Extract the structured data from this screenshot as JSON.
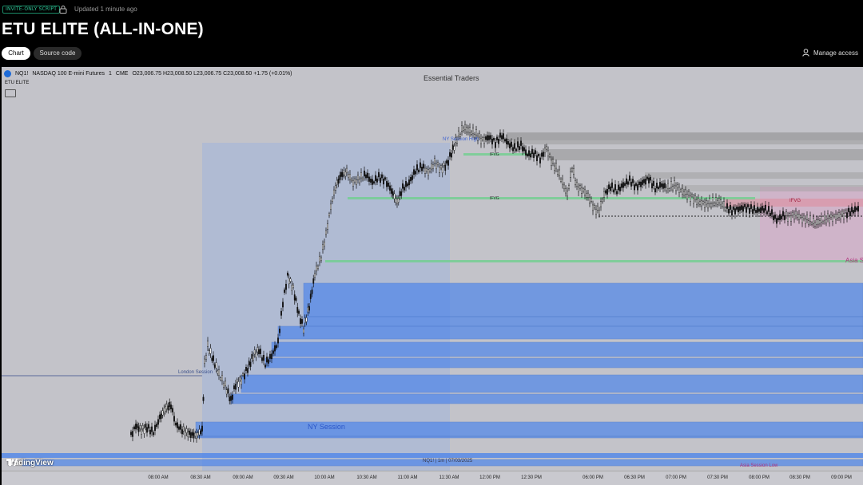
{
  "header": {
    "badge": "INVITE-ONLY SCRIPT",
    "updated": "Updated 1 minute ago",
    "title": "ETU ELITE (ALL-IN-ONE)",
    "tabs": [
      {
        "label": "Chart"
      },
      {
        "label": "Source code"
      }
    ],
    "manage_access": "Manage access"
  },
  "chart": {
    "symbol": "NQ1!",
    "description": "NASDAQ 100 E-mini Futures",
    "interval": "1",
    "exchange": "CME",
    "ohlc": "O23,006.75  H23,008.50  L23,006.75  C23,008.50  +1.75 (+0.01%)",
    "indicator": "ETU ELITE",
    "watermark": "Essential Traders",
    "brand": "TradingView",
    "footer": "NQ1!  |  1m  |  07/03/2025",
    "labels": {
      "ny_session_high": "NY Session High",
      "ny_session": "NY Session",
      "london_session": "London Session",
      "asia_s": "Asia S",
      "asia_session_low": "Asia Session Low",
      "ifvg": "IFVG"
    },
    "time_ticks": [
      "08:00 AM",
      "08:30 AM",
      "09:00 AM",
      "09:30 AM",
      "10:00 AM",
      "10:30 AM",
      "11:00 AM",
      "11:30 AM",
      "12:00 PM",
      "12:30 PM",
      "06:00 PM",
      "06:30 PM",
      "07:00 PM",
      "07:30 PM",
      "08:00 PM",
      "08:30 PM",
      "09:00 PM"
    ],
    "colors": {
      "background": "#c3c3c9",
      "ny_session_zone": "#a9b8d6",
      "fvg_blue": "#4f86ea",
      "ifvg_green": "#6fcf8f",
      "asia_zone": "#d9a8c8",
      "bear_zone_gray": "#8a8a8a",
      "candles": "#111111"
    }
  }
}
